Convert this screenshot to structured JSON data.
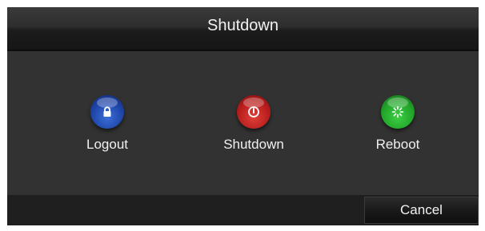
{
  "dialog": {
    "title": "Shutdown"
  },
  "actions": [
    {
      "label": "Logout",
      "icon": "lock-icon",
      "color": "#1f45a8"
    },
    {
      "label": "Shutdown",
      "icon": "power-icon",
      "color": "#b81e1c"
    },
    {
      "label": "Reboot",
      "icon": "reboot-icon",
      "color": "#22a52a"
    }
  ],
  "footer": {
    "cancel_label": "Cancel"
  }
}
